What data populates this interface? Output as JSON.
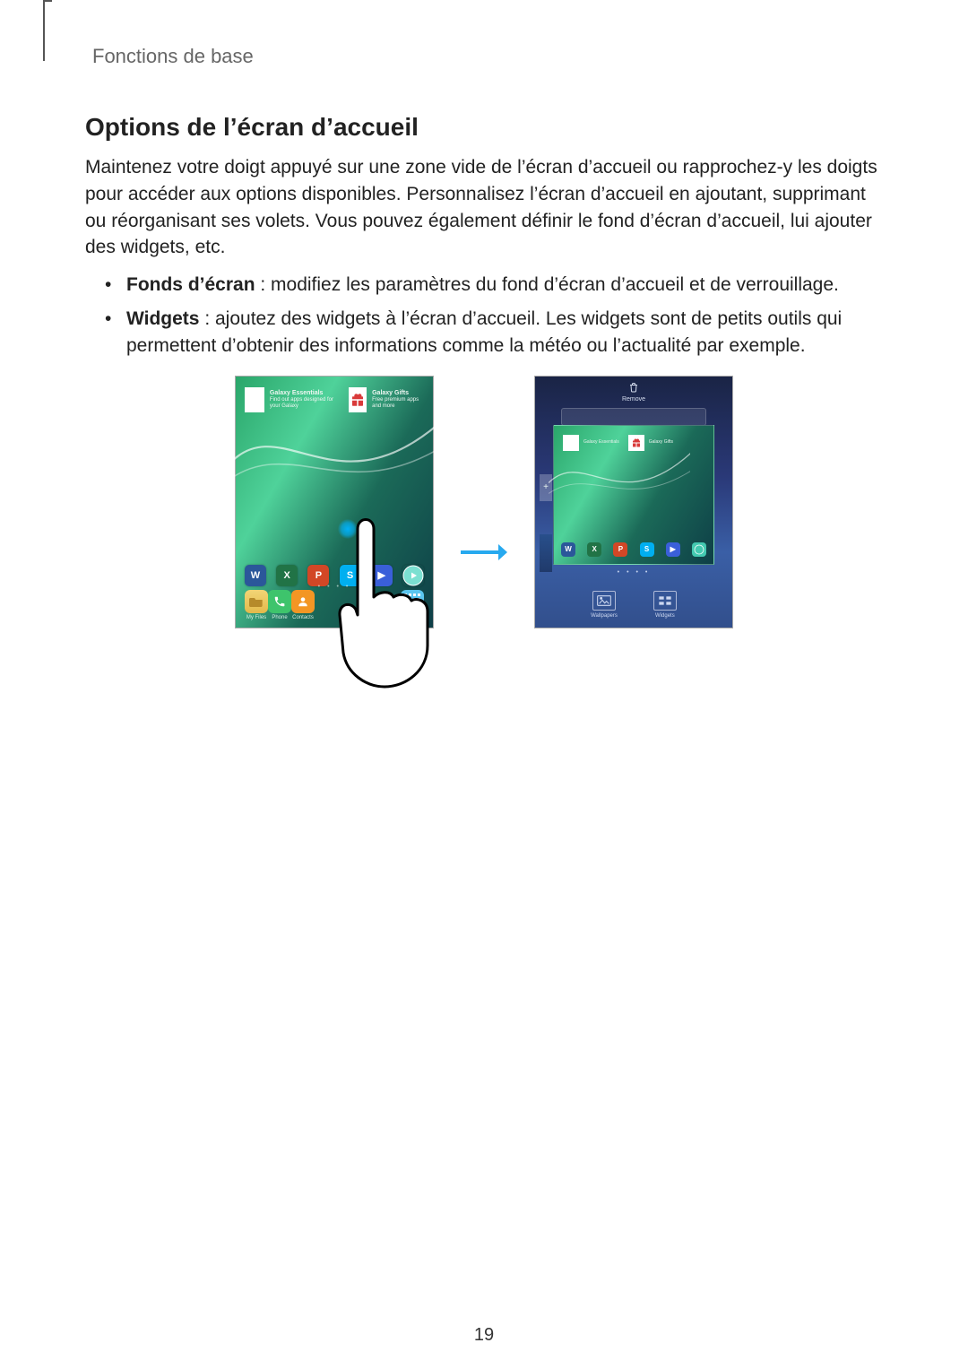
{
  "breadcrumb": "Fonctions de base",
  "heading": "Options de l’écran d’accueil",
  "paragraph": "Maintenez votre doigt appuyé sur une zone vide de l’écran d’accueil ou rapprochez-y les doigts pour accéder aux options disponibles. Personnalisez l’écran d’accueil en ajoutant, supprimant ou réorganisant ses volets. Vous pouvez également définir le fond d’écran d’accueil, lui ajouter des widgets, etc.",
  "bullets": [
    {
      "bold": "Fonds d’écran",
      "rest": " : modifiez les paramètres du fond d’écran d’accueil et de verrouillage."
    },
    {
      "bold": "Widgets",
      "rest": " : ajoutez des widgets à l’écran d’accueil. Les widgets sont de petits outils qui permettent d’obtenir des informations comme la météo ou l’actualité par exemple."
    }
  ],
  "figure": {
    "left": {
      "widget1_title": "Galaxy Essentials",
      "widget1_sub": "Find out apps designed for your Galaxy",
      "widget2_title": "Galaxy Gifts",
      "widget2_sub": "Free premium apps and more",
      "app_word": "W",
      "app_excel": "X",
      "app_ppt": "P",
      "app_skype": "S",
      "app_video": "▶",
      "dock1": "My Files",
      "dock2": "Phone",
      "dock3": "Contacts",
      "dock4": "Apps",
      "dots": "•  •  •  •"
    },
    "right": {
      "remove_label": "Remove",
      "plus": "+",
      "dots": "•  •  •  •",
      "widget1_title": "Galaxy Essentials",
      "widget2_title": "Galaxy Gifts",
      "action_wallpapers": "Wallpapers",
      "action_widgets": "Widgets"
    }
  },
  "page_number": "19"
}
